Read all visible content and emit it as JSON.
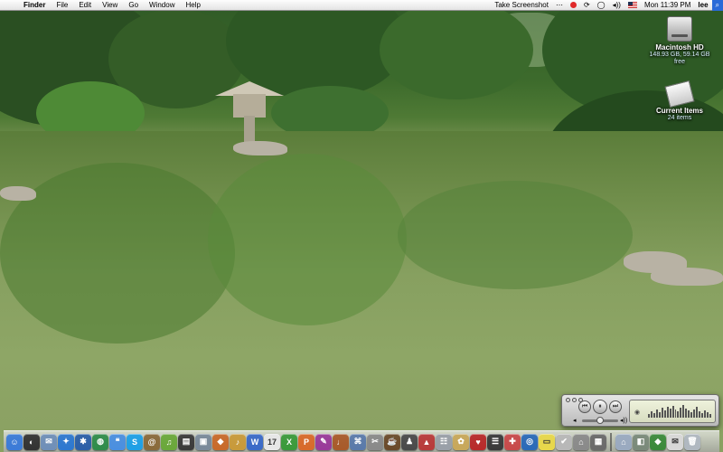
{
  "menubar": {
    "apple_icon": "apple-icon",
    "app_name": "Finder",
    "menus": [
      "File",
      "Edit",
      "View",
      "Go",
      "Window",
      "Help"
    ],
    "status": {
      "take_screenshot": "Take Screenshot",
      "clock": "Mon 11:39 PM",
      "user": "lee",
      "spotlight_icon": "spotlight-icon"
    }
  },
  "desktop": {
    "hard_drive": {
      "name": "Macintosh HD",
      "info": "148.93 GB, 59.14 GB free"
    },
    "folder": {
      "name": "Current Items",
      "info": "24 items"
    }
  },
  "mini_player": {
    "prev_symbol": "⏮",
    "pause_symbol": "⏸",
    "next_symbol": "⏭",
    "vol_low": "◂",
    "vol_high": "◂))",
    "lcd_mark": "◉",
    "volume": 0.5
  },
  "dock": {
    "items": [
      {
        "icon": "finder-icon",
        "color": "#3b7bd8",
        "glyph": "☺"
      },
      {
        "icon": "dashboard-icon",
        "color": "#333333",
        "glyph": "◐"
      },
      {
        "icon": "mail-icon",
        "color": "#6f8fb8",
        "glyph": "✉"
      },
      {
        "icon": "safari-icon",
        "color": "#2d78d0",
        "glyph": "✦"
      },
      {
        "icon": "app-icon-5",
        "color": "#2b5fa8",
        "glyph": "✱"
      },
      {
        "icon": "network-globe-icon",
        "color": "#2f8c4a",
        "glyph": "◍"
      },
      {
        "icon": "ichat-icon",
        "color": "#4a8fe0",
        "glyph": "❝"
      },
      {
        "icon": "skype-icon",
        "color": "#1ea0e6",
        "glyph": "S"
      },
      {
        "icon": "address-book-icon",
        "color": "#8a6a3a",
        "glyph": "@"
      },
      {
        "icon": "itunes-icon",
        "color": "#6aa83a",
        "glyph": "♫"
      },
      {
        "icon": "imovie-icon",
        "color": "#3a3a3a",
        "glyph": "▤"
      },
      {
        "icon": "iphoto-icon",
        "color": "#7a8a9a",
        "glyph": "▣"
      },
      {
        "icon": "app-icon-13",
        "color": "#c86a2a",
        "glyph": "◆"
      },
      {
        "icon": "garageband-icon",
        "color": "#c89a3a",
        "glyph": "♪"
      },
      {
        "icon": "word-icon",
        "color": "#3a6ac8",
        "glyph": "W"
      },
      {
        "icon": "ical-icon",
        "color": "#e8e8e8",
        "glyph": "17"
      },
      {
        "icon": "excel-icon",
        "color": "#3a9a3a",
        "glyph": "X"
      },
      {
        "icon": "powerpoint-icon",
        "color": "#d86a2a",
        "glyph": "P"
      },
      {
        "icon": "app-icon-19",
        "color": "#9a3a9a",
        "glyph": "✎"
      },
      {
        "icon": "guitar-icon",
        "color": "#a85a2a",
        "glyph": "♩"
      },
      {
        "icon": "app-icon-21",
        "color": "#5a7aaa",
        "glyph": "⌘"
      },
      {
        "icon": "app-icon-22",
        "color": "#8a8a8a",
        "glyph": "✂"
      },
      {
        "icon": "coffee-icon",
        "color": "#6a4a2a",
        "glyph": "☕"
      },
      {
        "icon": "app-icon-24",
        "color": "#4a4a4a",
        "glyph": "♟"
      },
      {
        "icon": "app-icon-25",
        "color": "#b83a3a",
        "glyph": "▲"
      },
      {
        "icon": "app-icon-26",
        "color": "#9aa0a8",
        "glyph": "☷"
      },
      {
        "icon": "app-icon-27",
        "color": "#c8a85a",
        "glyph": "✿"
      },
      {
        "icon": "app-icon-28",
        "color": "#b82a2a",
        "glyph": "♥"
      },
      {
        "icon": "app-icon-29",
        "color": "#3a3a3a",
        "glyph": "☰"
      },
      {
        "icon": "app-icon-30",
        "color": "#c84a4a",
        "glyph": "✚"
      },
      {
        "icon": "app-icon-31",
        "color": "#2a6ab8",
        "glyph": "◎"
      },
      {
        "icon": "stickies-icon",
        "color": "#e8d84a",
        "glyph": "▭"
      },
      {
        "icon": "app-icon-33",
        "color": "#b8b8b8",
        "glyph": "✔"
      },
      {
        "icon": "app-icon-34",
        "color": "#8a8a8a",
        "glyph": "⌂"
      },
      {
        "icon": "app-icon-35",
        "color": "#6a6a6a",
        "glyph": "▦"
      }
    ],
    "trailing": [
      {
        "icon": "home-folder-icon",
        "color": "#9aaac0",
        "glyph": "⌂"
      },
      {
        "icon": "stack-icon",
        "color": "#7a8a7a",
        "glyph": "◧"
      },
      {
        "icon": "app-icon-38",
        "color": "#3a8a3a",
        "glyph": "◆"
      },
      {
        "icon": "mail-stack-icon",
        "color": "#d8d8d8",
        "glyph": "✉"
      },
      {
        "icon": "trash-icon",
        "color": "#b0b8c0",
        "glyph": "🗑"
      }
    ]
  }
}
